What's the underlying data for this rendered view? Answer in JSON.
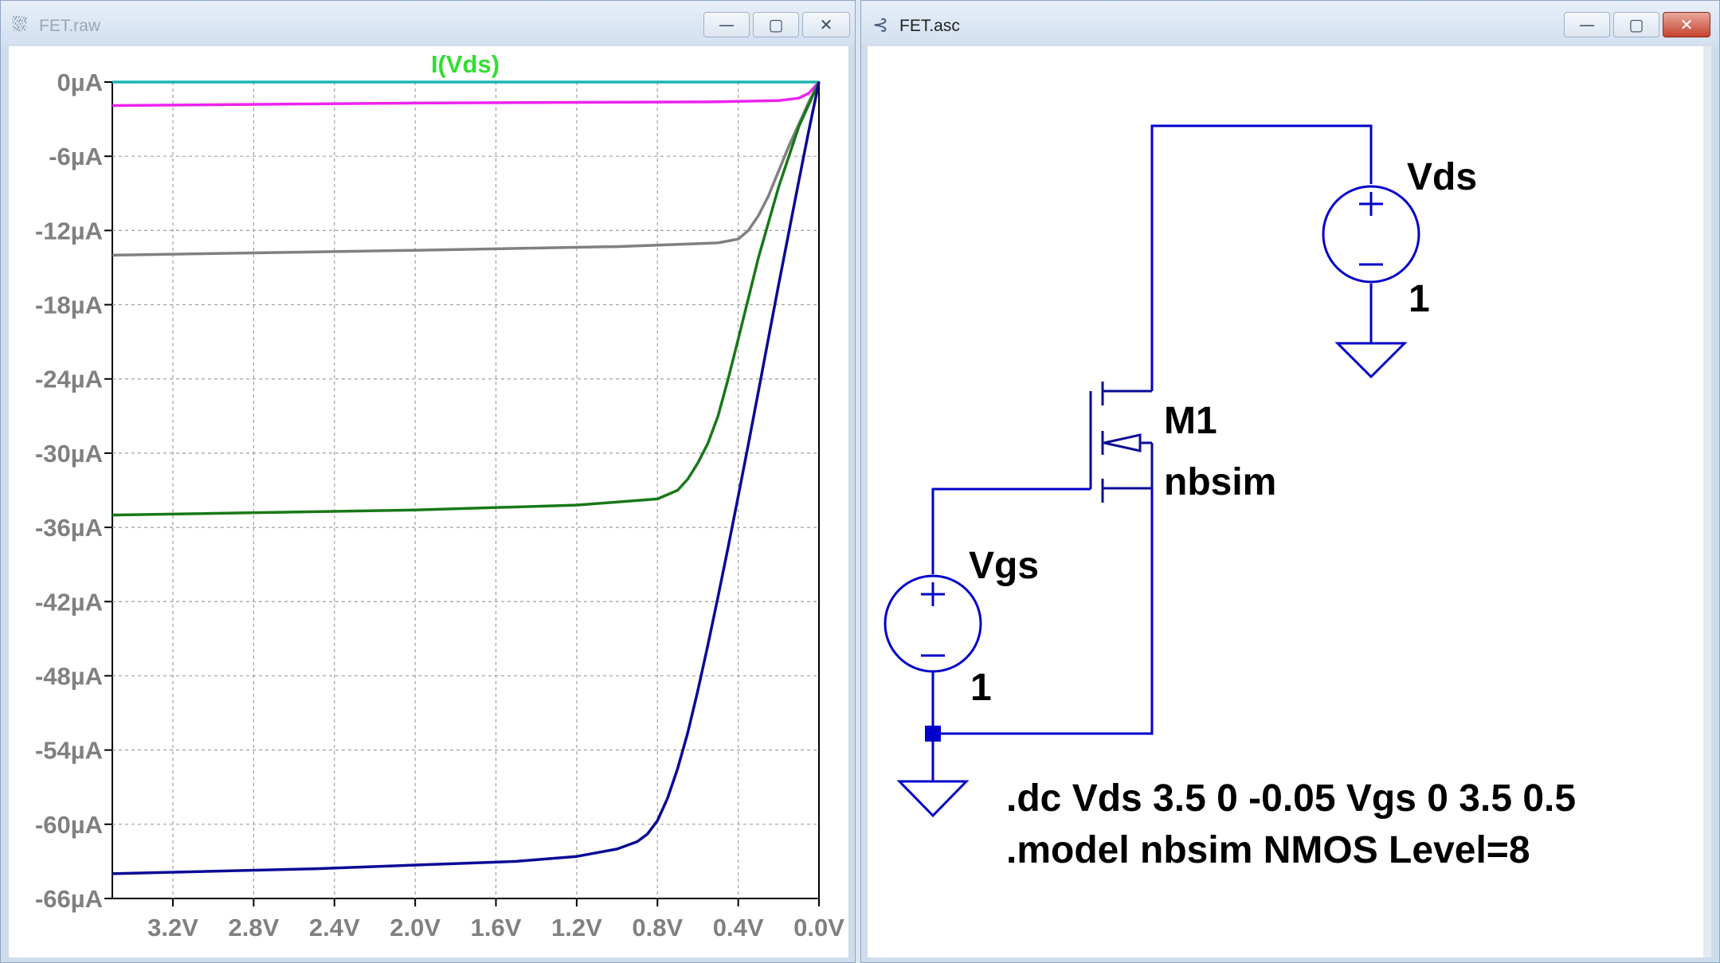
{
  "plot_window": {
    "title": "FET.raw",
    "icon": "waveform-icon",
    "buttons": {
      "minimize": "—",
      "maximize": "▢",
      "close": "✕"
    }
  },
  "schematic_window": {
    "title": "FET.asc",
    "icon": "schematic-icon",
    "buttons": {
      "minimize": "—",
      "maximize": "▢",
      "close": "✕"
    }
  },
  "chart_data": {
    "type": "line",
    "title": "I(Vds)",
    "title_color": "#33dd33",
    "x_ticks": [
      "3.2V",
      "2.8V",
      "2.4V",
      "2.0V",
      "1.6V",
      "1.2V",
      "0.8V",
      "0.4V",
      "0.0V"
    ],
    "y_ticks": [
      "0µA",
      "-6µA",
      "-12µA",
      "-18µA",
      "-24µA",
      "-30µA",
      "-36µA",
      "-42µA",
      "-48µA",
      "-54µA",
      "-60µA",
      "-66µA"
    ],
    "xlim": [
      3.5,
      0
    ],
    "ylim": [
      -66,
      0
    ],
    "grid": true,
    "series": [
      {
        "color": "#1cb3b3",
        "x": [
          3.5,
          0
        ],
        "y": [
          0,
          0
        ]
      },
      {
        "color": "#ee22ee",
        "x": [
          3.5,
          2.0,
          0.5,
          0.2,
          0.1,
          0.05,
          0
        ],
        "y": [
          -1.9,
          -1.7,
          -1.6,
          -1.5,
          -1.3,
          -0.9,
          0
        ]
      },
      {
        "color": "#808080",
        "x": [
          3.5,
          2.0,
          1.0,
          0.5,
          0.4,
          0.35,
          0.3,
          0.25,
          0.2,
          0.15,
          0.1,
          0.05,
          0
        ],
        "y": [
          -14.0,
          -13.6,
          -13.3,
          -13.0,
          -12.7,
          -12.0,
          -10.8,
          -9.2,
          -7.2,
          -5.2,
          -3.4,
          -1.6,
          0
        ]
      },
      {
        "color": "#187818",
        "x": [
          3.5,
          2.0,
          1.2,
          0.8,
          0.7,
          0.65,
          0.6,
          0.55,
          0.5,
          0.45,
          0.4,
          0.35,
          0.3,
          0.2,
          0.1,
          0
        ],
        "y": [
          -35.0,
          -34.6,
          -34.2,
          -33.7,
          -33.0,
          -32.1,
          -30.8,
          -29.2,
          -27.0,
          -24.0,
          -20.8,
          -17.5,
          -14.2,
          -8.5,
          -3.6,
          0
        ]
      },
      {
        "color": "#0a0a96",
        "x": [
          3.5,
          2.5,
          1.5,
          1.2,
          1.0,
          0.9,
          0.85,
          0.8,
          0.75,
          0.7,
          0.65,
          0.6,
          0.55,
          0.5,
          0.45,
          0.4,
          0.35,
          0.3,
          0.25,
          0.2,
          0.15,
          0.1,
          0.05,
          0
        ],
        "y": [
          -64.0,
          -63.6,
          -63.0,
          -62.6,
          -62.0,
          -61.4,
          -60.8,
          -59.7,
          -57.9,
          -55.5,
          -52.6,
          -49.2,
          -45.5,
          -41.6,
          -37.6,
          -33.5,
          -29.3,
          -25.0,
          -20.7,
          -16.4,
          -12.2,
          -8.0,
          -3.9,
          0
        ]
      }
    ]
  },
  "schematic": {
    "wire_color": "#0000cc",
    "vds": {
      "name": "Vds",
      "value": "1"
    },
    "vgs": {
      "name": "Vgs",
      "value": "1"
    },
    "mosfet": {
      "name": "M1",
      "model": "nbsim"
    },
    "directives": [
      ".dc Vds 3.5 0 -0.05 Vgs 0 3.5 0.5",
      ".model nbsim NMOS Level=8"
    ]
  }
}
